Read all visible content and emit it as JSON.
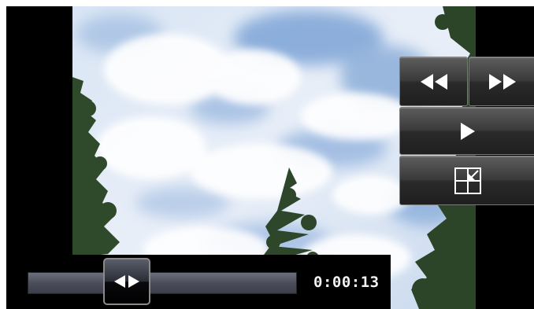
{
  "player": {
    "time_display": "0:00:13",
    "seek_progress": 0.37
  },
  "controls": {
    "rewind_icon": "rewind-icon",
    "fast_forward_icon": "fast-forward-icon",
    "play_icon": "play-icon",
    "window_size_icon": "window-size-icon",
    "seek_thumb_icon": "seek-arrows-icon"
  },
  "colors": {
    "sky_light": "#eef3fb",
    "sky_blue": "#8fb1dc",
    "button_face": "#3a3a3a",
    "seek_track": "#4b4e5a",
    "time_text": "#f2f2f2"
  }
}
